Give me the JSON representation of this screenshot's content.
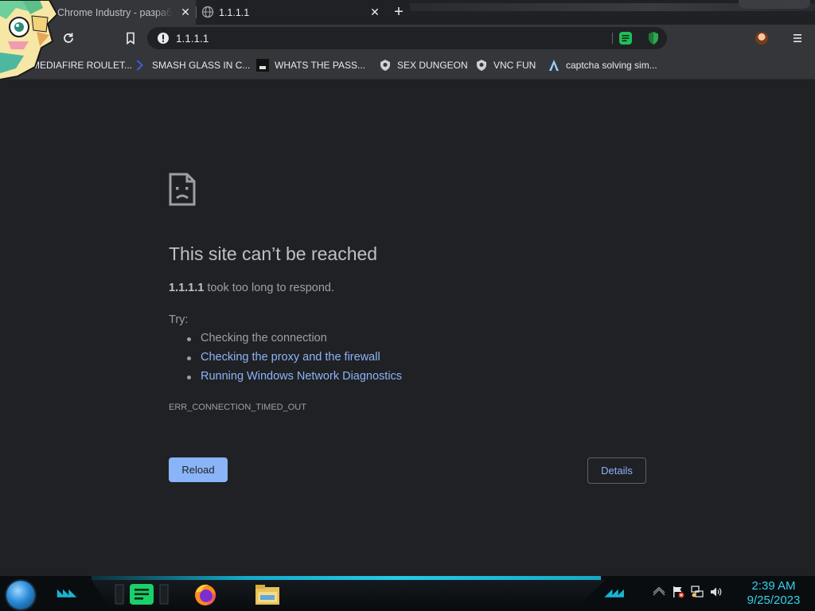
{
  "browser": {
    "tabs": [
      {
        "title": "Chrome Industry - разработка"
      },
      {
        "title": "1.1.1.1"
      }
    ],
    "address_bar": {
      "url": "1.1.1.1"
    }
  },
  "bookmarks": [
    {
      "label": "MEDIAFIRE ROULET...",
      "icon": "mediafire-icon"
    },
    {
      "label": "SMASH GLASS IN C...",
      "icon": "bracket-icon"
    },
    {
      "label": "WHATS THE PASS...",
      "icon": "dark-square-icon"
    },
    {
      "label": "SEX DUNGEON",
      "icon": "shield-logo-icon"
    },
    {
      "label": "VNC FUN",
      "icon": "shield-logo-icon"
    },
    {
      "label": "captcha solving sim...",
      "icon": "caret-icon"
    }
  ],
  "error_page": {
    "title": "This site can’t be reached",
    "host": "1.1.1.1",
    "message": "took too long to respond.",
    "try_label": "Try:",
    "suggestions": [
      "Checking the connection",
      "Checking the proxy and the firewall",
      "Running Windows Network Diagnostics"
    ],
    "error_code": "ERR_CONNECTION_TIMED_OUT",
    "reload_label": "Reload",
    "details_label": "Details"
  },
  "taskbar": {
    "time": "2:39 AM",
    "date": "9/25/2023",
    "apps": [
      "messenger-icon",
      "firefox-icon",
      "file-explorer-icon"
    ]
  },
  "colors": {
    "page_bg": "#202124",
    "link": "#8ab4f8",
    "clock": "#33d1ea"
  }
}
